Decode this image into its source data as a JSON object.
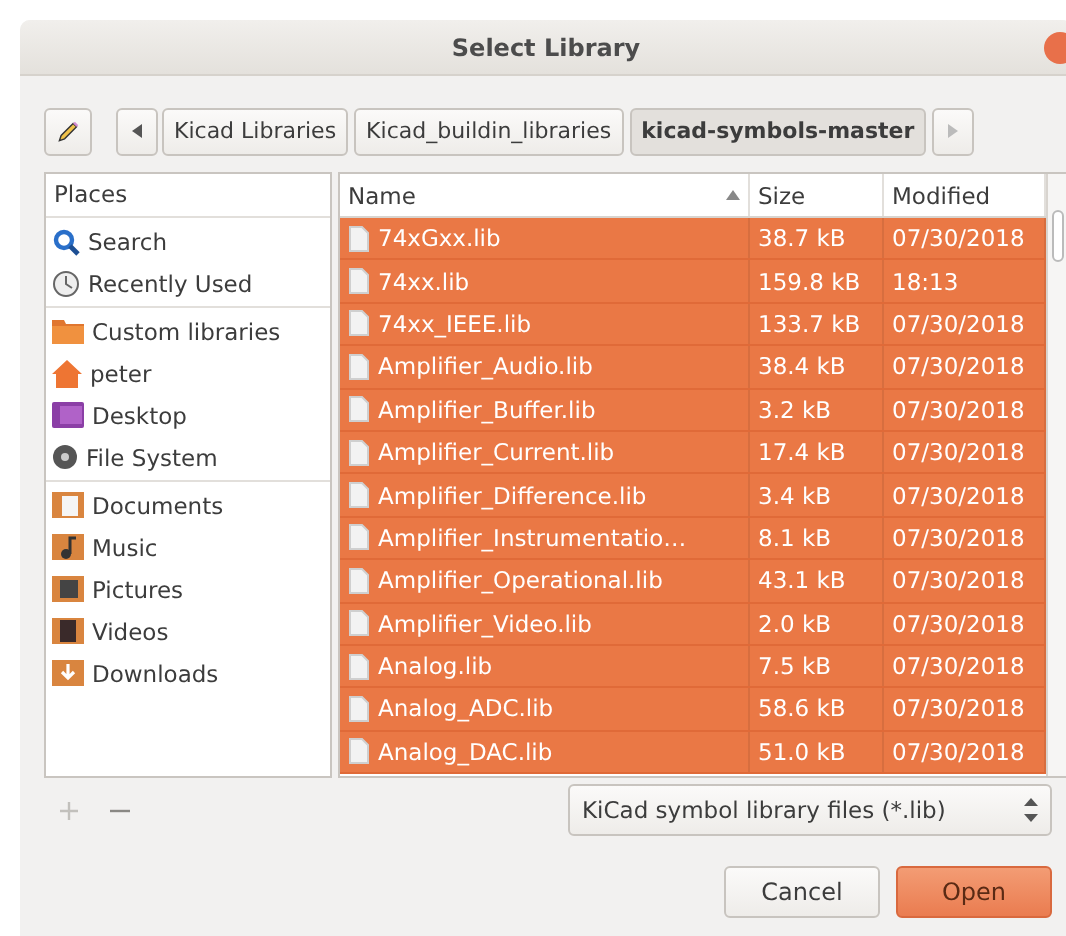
{
  "window": {
    "title": "Select Library"
  },
  "path_bar": {
    "segments": [
      {
        "label": "Kicad Libraries",
        "selected": false
      },
      {
        "label": "Kicad_buildin_libraries",
        "selected": false
      },
      {
        "label": "kicad-symbols-master",
        "selected": true
      }
    ]
  },
  "places": {
    "heading": "Places",
    "groups": [
      [
        "Search",
        "Recently Used"
      ],
      [
        "Custom libraries",
        "peter",
        "Desktop",
        "File System"
      ],
      [
        "Documents",
        "Music",
        "Pictures",
        "Videos",
        "Downloads"
      ]
    ]
  },
  "table": {
    "columns": [
      "Name",
      "Size",
      "Modified"
    ],
    "rows": [
      {
        "name": "74xGxx.lib",
        "size": "38.7 kB",
        "modified": "07/30/2018",
        "selected": true
      },
      {
        "name": "74xx.lib",
        "size": "159.8 kB",
        "modified": "18:13",
        "selected": true
      },
      {
        "name": "74xx_IEEE.lib",
        "size": "133.7 kB",
        "modified": "07/30/2018",
        "selected": true
      },
      {
        "name": "Amplifier_Audio.lib",
        "size": "38.4 kB",
        "modified": "07/30/2018",
        "selected": true
      },
      {
        "name": "Amplifier_Buffer.lib",
        "size": "3.2 kB",
        "modified": "07/30/2018",
        "selected": true
      },
      {
        "name": "Amplifier_Current.lib",
        "size": "17.4 kB",
        "modified": "07/30/2018",
        "selected": true
      },
      {
        "name": "Amplifier_Difference.lib",
        "size": "3.4 kB",
        "modified": "07/30/2018",
        "selected": true
      },
      {
        "name": "Amplifier_Instrumentatio…",
        "size": "8.1 kB",
        "modified": "07/30/2018",
        "selected": true
      },
      {
        "name": "Amplifier_Operational.lib",
        "size": "43.1 kB",
        "modified": "07/30/2018",
        "selected": true
      },
      {
        "name": "Amplifier_Video.lib",
        "size": "2.0 kB",
        "modified": "07/30/2018",
        "selected": true
      },
      {
        "name": "Analog.lib",
        "size": "7.5 kB",
        "modified": "07/30/2018",
        "selected": true
      },
      {
        "name": "Analog_ADC.lib",
        "size": "58.6 kB",
        "modified": "07/30/2018",
        "selected": true
      },
      {
        "name": "Analog_DAC.lib",
        "size": "51.0 kB",
        "modified": "07/30/2018",
        "selected": true
      }
    ]
  },
  "filter": {
    "value": "KiCad symbol library files (*.lib)"
  },
  "buttons": [
    {
      "label": "Cancel",
      "kind": "normal"
    },
    {
      "label": "Open",
      "kind": "primary"
    }
  ]
}
